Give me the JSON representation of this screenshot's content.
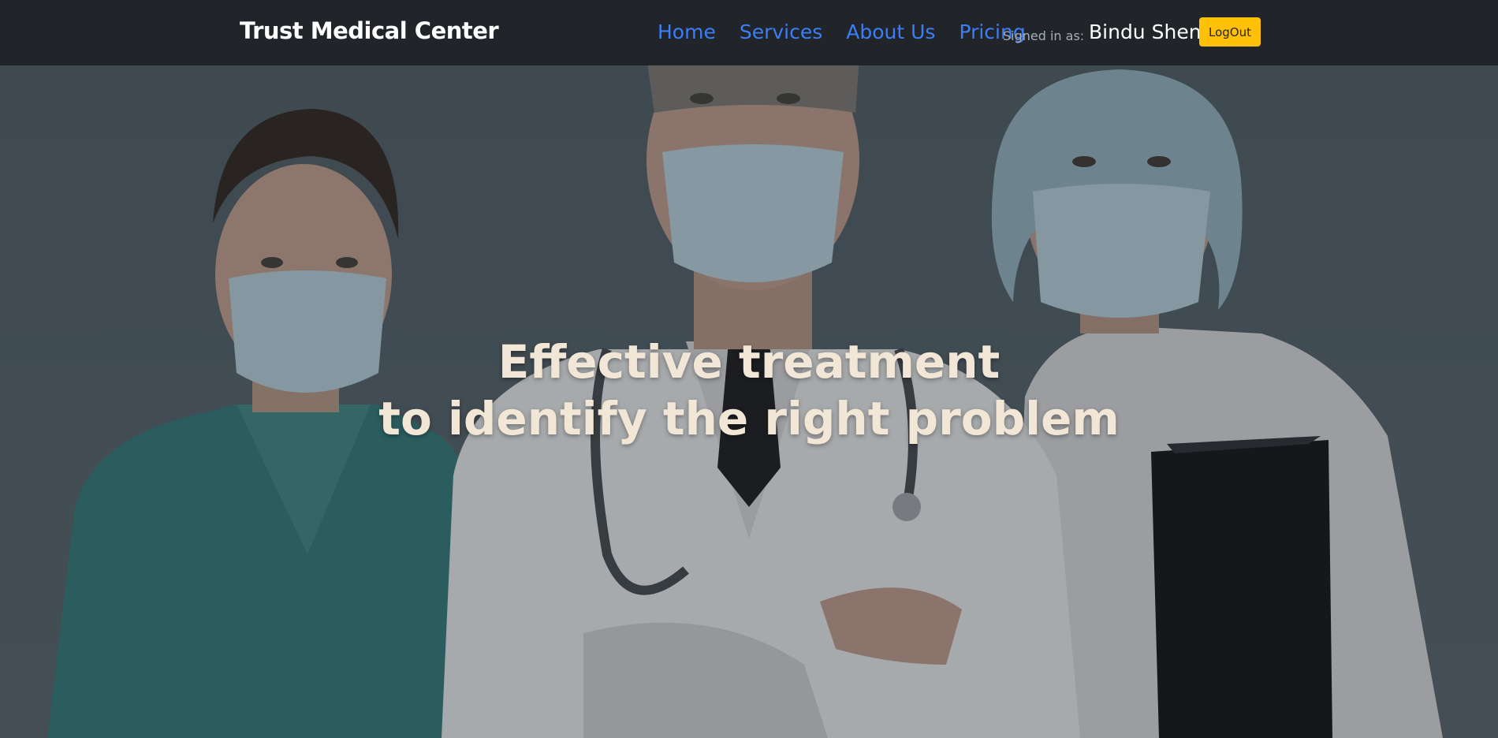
{
  "navbar": {
    "brand": "Trust Medical Center",
    "links": [
      {
        "label": "Home"
      },
      {
        "label": "Services"
      },
      {
        "label": "About Us"
      },
      {
        "label": "Pricing"
      }
    ],
    "signed_in_label": "Signed in as:",
    "user_name": "Bindu Shen",
    "logout_label": "LogOut"
  },
  "hero": {
    "headline_line1": "Effective treatment",
    "headline_line2": "to identify the right problem",
    "image_description": "three medical staff in masks"
  },
  "colors": {
    "navbar_bg": "#212529",
    "nav_link": "#3d7df6",
    "logout_bg": "#ffc107",
    "headline": "#f2e6d6"
  }
}
